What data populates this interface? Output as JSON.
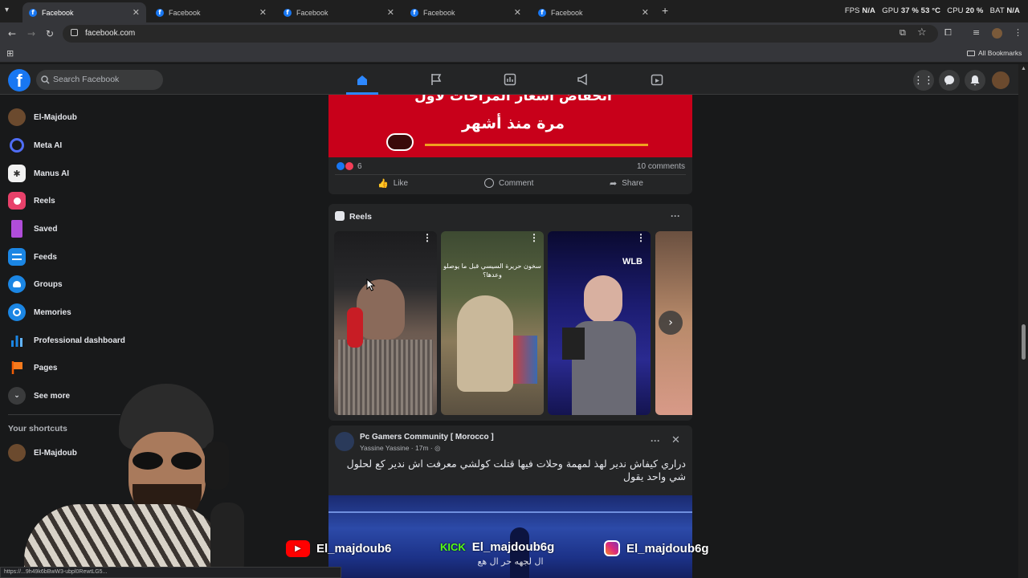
{
  "browser": {
    "tabs": [
      {
        "title": "Facebook",
        "active": true
      },
      {
        "title": "Facebook",
        "active": false
      },
      {
        "title": "Facebook",
        "active": false
      },
      {
        "title": "Facebook",
        "active": false
      },
      {
        "title": "Facebook",
        "active": false
      }
    ],
    "new_tab": "+",
    "url": "facebook.com",
    "all_bookmarks": "All Bookmarks",
    "perf": {
      "fps_label": "FPS",
      "fps_value": "N/A",
      "gpu_label": "GPU",
      "gpu_value": "37 % 53 °C",
      "cpu_label": "CPU",
      "cpu_value": "20 %",
      "bat_label": "BAT",
      "bat_value": "N/A"
    }
  },
  "header": {
    "logo": "f",
    "search_placeholder": "Search Facebook"
  },
  "sidebar": {
    "items": [
      {
        "label": "El-Majdoub",
        "icon": "avatar"
      },
      {
        "label": "Meta AI",
        "icon": "meta-ai-icon"
      },
      {
        "label": "Manus AI",
        "icon": "manus-icon"
      },
      {
        "label": "Reels",
        "icon": "reels-icon"
      },
      {
        "label": "Saved",
        "icon": "bookmark-icon"
      },
      {
        "label": "Feeds",
        "icon": "feeds-icon"
      },
      {
        "label": "Groups",
        "icon": "groups-icon"
      },
      {
        "label": "Memories",
        "icon": "clock-icon"
      },
      {
        "label": "Professional dashboard",
        "icon": "dashboard-icon"
      },
      {
        "label": "Pages",
        "icon": "flag-icon"
      },
      {
        "label": "See more",
        "icon": "chevron-down-icon"
      }
    ],
    "shortcuts_heading": "Your shortcuts",
    "shortcut_item": "El-Majdoub"
  },
  "post1": {
    "banner_line1": "انخفاض أسعار المراحات لأول",
    "banner_line2": "مرة منذ أشهر",
    "reaction_count": "6",
    "comments": "10 comments",
    "like": "Like",
    "comment": "Comment",
    "share": "Share"
  },
  "reels_section": {
    "title": "Reels",
    "reel2_caption": "سخون حريرة السيسي قبل ما يوصلو وعدها؟",
    "reel3_watermark": "WLB"
  },
  "post2": {
    "group": "Pc Gamers Community [ Morocco ]",
    "author": "Yassine Yassine",
    "time": "17m",
    "text_line1": "دراري كيفاش ندير لهذ لمهمة وحلات فيها قتلت كولشي معرفت اش ندير كع لحلول",
    "text_line2": "شي واحد يقول",
    "video_caption": "ال لجهه حر ال هع"
  },
  "overlay": {
    "youtube": "El_majdoub6",
    "kick": "El_majdoub6g",
    "instagram": "El_majdoub6g",
    "status_url": "https://...9h49k6bBwW3-ubpl0RewtLG5..."
  },
  "colors": {
    "fb_blue": "#1877f2",
    "banner_red": "#c8001a",
    "background": "#18191a",
    "card": "#242526"
  }
}
